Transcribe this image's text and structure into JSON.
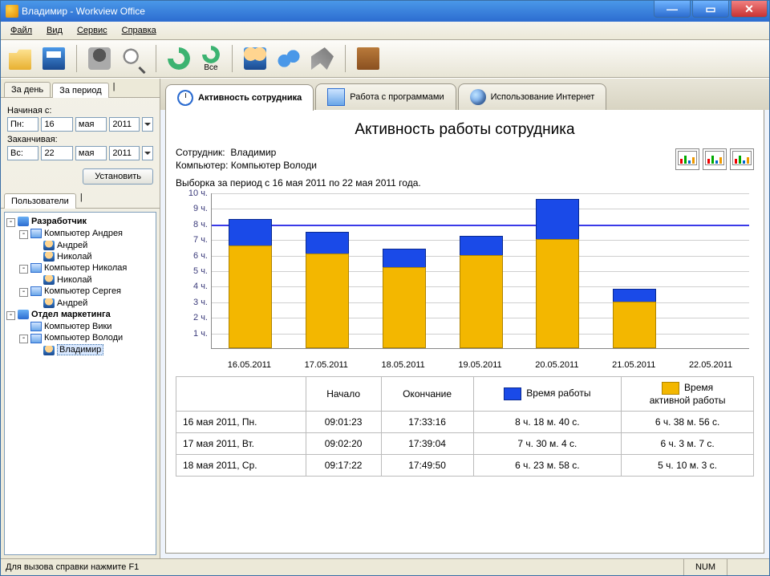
{
  "window": {
    "title": "Владимир - Workview Office"
  },
  "menu": {
    "file": "Файл",
    "view": "Вид",
    "service": "Сервис",
    "help": "Справка"
  },
  "toolbar": {
    "refresh_all_label": "Все"
  },
  "left": {
    "tabs": {
      "day": "За день",
      "period": "За период"
    },
    "from_label": "Начиная с:",
    "to_label": "Заканчивая:",
    "from": {
      "dow": "Пн:",
      "day": "16",
      "month": "мая",
      "year": "2011"
    },
    "to": {
      "dow": "Вс:",
      "day": "22",
      "month": "мая",
      "year": "2011"
    },
    "set_btn": "Установить",
    "users_tab": "Пользователи",
    "tree": [
      {
        "lvl": 0,
        "tog": "-",
        "ico": "folder",
        "label": "Разработчик",
        "bold": true
      },
      {
        "lvl": 1,
        "tog": "-",
        "ico": "comp",
        "label": "Компьютер Андрея"
      },
      {
        "lvl": 2,
        "tog": "",
        "ico": "user",
        "label": "Андрей"
      },
      {
        "lvl": 2,
        "tog": "",
        "ico": "user",
        "label": "Николай"
      },
      {
        "lvl": 1,
        "tog": "-",
        "ico": "comp",
        "label": "Компьютер Николая"
      },
      {
        "lvl": 2,
        "tog": "",
        "ico": "user",
        "label": "Николай"
      },
      {
        "lvl": 1,
        "tog": "-",
        "ico": "comp",
        "label": "Компьютер Сергея"
      },
      {
        "lvl": 2,
        "tog": "",
        "ico": "user",
        "label": "Андрей"
      },
      {
        "lvl": 0,
        "tog": "-",
        "ico": "folder",
        "label": "Отдел маркетинга",
        "bold": true
      },
      {
        "lvl": 1,
        "tog": "",
        "ico": "comp",
        "label": "Компьютер Вики"
      },
      {
        "lvl": 1,
        "tog": "-",
        "ico": "comp",
        "label": "Компьютер Володи"
      },
      {
        "lvl": 2,
        "tog": "",
        "ico": "user",
        "label": "Владимир",
        "sel": true
      }
    ]
  },
  "tabs": {
    "activity": "Активность сотрудника",
    "programs": "Работа с программами",
    "internet": "Использование Интернет"
  },
  "report": {
    "title": "Активность работы сотрудника",
    "emp_label": "Сотрудник:",
    "emp_value": "Владимир",
    "comp_label": "Компьютер:",
    "comp_value": "Компьютер Володи",
    "selection": "Выборка за период с 16 мая 2011 по 22 мая 2011 года."
  },
  "chart_data": {
    "type": "bar",
    "ylabel": "ч.",
    "ylim": [
      0,
      10
    ],
    "reference_line": 8,
    "categories": [
      "16.05.2011",
      "17.05.2011",
      "18.05.2011",
      "19.05.2011",
      "20.05.2011",
      "21.05.2011",
      "22.05.2011"
    ],
    "series": [
      {
        "name": "Время работы",
        "color": "#1a4ae8",
        "values": [
          8.3,
          7.5,
          6.4,
          7.2,
          9.6,
          3.8,
          0
        ]
      },
      {
        "name": "Время активной работы",
        "color": "#f3b700",
        "values": [
          6.6,
          6.1,
          5.2,
          6.0,
          7.0,
          3.0,
          0
        ]
      }
    ],
    "yticks": [
      "1 ч.",
      "2 ч.",
      "3 ч.",
      "4 ч.",
      "5 ч.",
      "6 ч.",
      "7 ч.",
      "8 ч.",
      "9 ч.",
      "10 ч."
    ]
  },
  "table": {
    "headers": {
      "c1": "",
      "c2": "Начало",
      "c3": "Окончание",
      "c4": "Время работы",
      "c5": "Время\nактивной работы"
    },
    "rows": [
      {
        "c1": "16 мая 2011, Пн.",
        "c2": "09:01:23",
        "c3": "17:33:16",
        "c4": "8 ч. 18 м. 40 с.",
        "c5": "6 ч. 38 м. 56 с."
      },
      {
        "c1": "17 мая 2011, Вт.",
        "c2": "09:02:20",
        "c3": "17:39:04",
        "c4": "7 ч. 30 м. 4 с.",
        "c5": "6 ч. 3 м. 7 с."
      },
      {
        "c1": "18 мая 2011, Ср.",
        "c2": "09:17:22",
        "c3": "17:49:50",
        "c4": "6 ч. 23 м. 58 с.",
        "c5": "5 ч. 10 м. 3 с."
      }
    ]
  },
  "status": {
    "hint": "Для вызова справки нажмите F1",
    "num": "NUM"
  }
}
